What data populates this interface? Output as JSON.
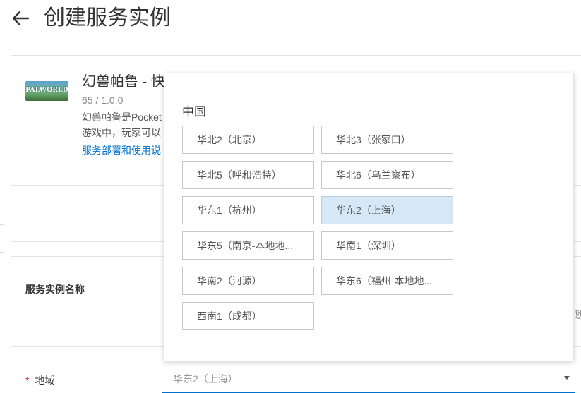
{
  "header": {
    "title": "创建服务实例"
  },
  "service": {
    "logo_text": "PALWORLD",
    "name": "幻兽帕鲁 - 快",
    "meta": "65 / 1.0.0",
    "desc_line1": "幻兽帕鲁是Pocket",
    "desc_line2": "游戏中，玩家可以",
    "link": "服务部署和使用说"
  },
  "instance_name": {
    "label": "服务实例名称",
    "edge_text": "划"
  },
  "region": {
    "required_mark": "*",
    "label": "地域",
    "value": "华东2（上海）"
  },
  "dropdown": {
    "group": "中国",
    "options": [
      {
        "label": "华北2（北京）",
        "selected": false
      },
      {
        "label": "华北3（张家口）",
        "selected": false
      },
      {
        "label": "华北5（呼和浩特）",
        "selected": false
      },
      {
        "label": "华北6（乌兰察布）",
        "selected": false
      },
      {
        "label": "华东1（杭州）",
        "selected": false
      },
      {
        "label": "华东2（上海）",
        "selected": true
      },
      {
        "label": "华东5（南京-本地地...",
        "selected": false
      },
      {
        "label": "华南1（深圳）",
        "selected": false
      },
      {
        "label": "华南2（河源）",
        "selected": false
      },
      {
        "label": "华东6（福州-本地地...",
        "selected": false
      },
      {
        "label": "西南1（成都）",
        "selected": false
      }
    ]
  },
  "colors": {
    "accent": "#0070cc",
    "selected_bg": "#d6e8f5",
    "required": "#d93026"
  }
}
